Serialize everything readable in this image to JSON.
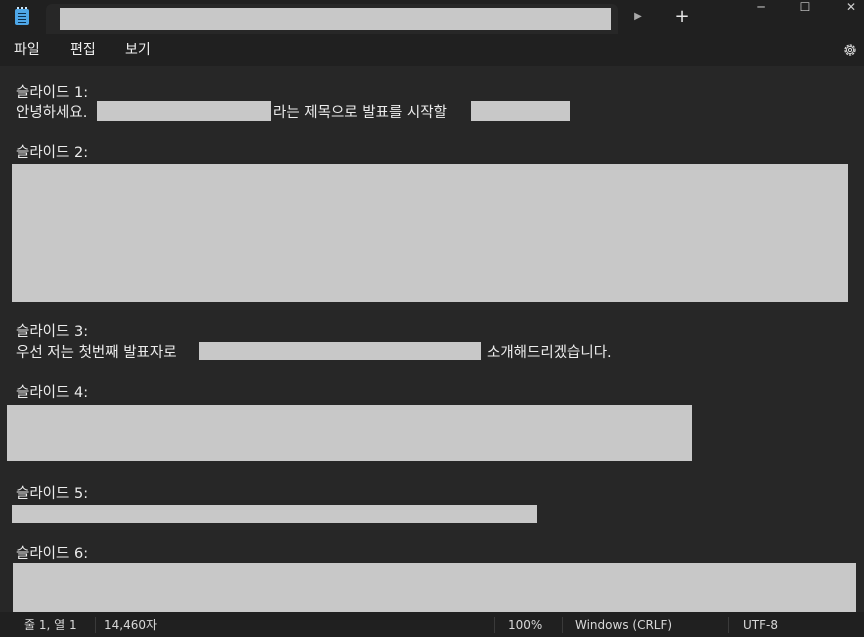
{
  "titlebar": {
    "new_tab_symbol": "+",
    "tab_more_symbol": "▶",
    "minimize_symbol": "─",
    "maximize_symbol": "☐",
    "close_symbol": "✕"
  },
  "menu": {
    "file": "파일",
    "edit": "편집",
    "view": "보기"
  },
  "document": {
    "slide1_heading": "슬라이드 1:",
    "slide1_text_a": "안녕하세요.",
    "slide1_text_b": "라는 제목으로 발표를 시작할",
    "slide2_heading": "슬라이드 2:",
    "slide3_heading": "슬라이드 3:",
    "slide3_text_a": "우선 저는 첫번째 발표자로",
    "slide3_text_b": "소개해드리겠습니다.",
    "slide4_heading": "슬라이드 4:",
    "slide5_heading": "슬라이드 5:",
    "slide6_heading": "슬라이드 6:"
  },
  "status": {
    "position": "줄 1, 열 1",
    "char_count": "14,460자",
    "zoom": "100%",
    "line_ending": "Windows (CRLF)",
    "encoding": "UTF-8"
  },
  "icons": {
    "app": "notepad-icon",
    "settings": "gear-icon"
  }
}
